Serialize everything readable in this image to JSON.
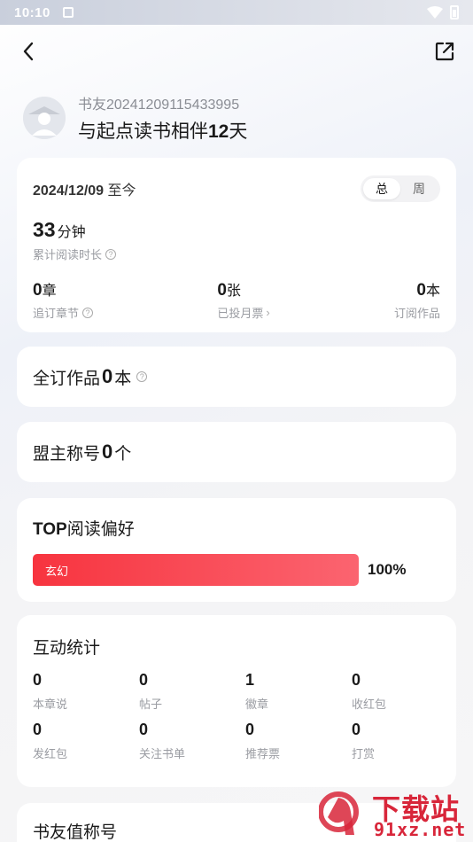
{
  "status_bar": {
    "time": "10:10"
  },
  "profile": {
    "username": "书友20241209115433995",
    "companion_prefix": "与起点读书相伴",
    "companion_days": "12",
    "companion_suffix": "天"
  },
  "stats": {
    "date_range": "2024/12/09",
    "date_suffix": "至今",
    "toggle": [
      "总",
      "周"
    ],
    "read_time_value": "33",
    "read_time_unit": "分钟",
    "read_time_label": "累计阅读时长",
    "chapters_value": "0",
    "chapters_unit": "章",
    "chapters_label": "追订章节",
    "votes_value": "0",
    "votes_unit": "张",
    "votes_label": "已投月票",
    "subscribed_value": "0",
    "subscribed_unit": "本",
    "subscribed_label": "订阅作品"
  },
  "full_sub": {
    "label": "全订作品",
    "value": "0",
    "unit": "本"
  },
  "leader": {
    "label": "盟主称号",
    "value": "0",
    "unit": "个"
  },
  "top_pref": {
    "title_bold": "TOP",
    "title_rest": "阅读偏好",
    "genre": "玄幻",
    "percent_text": "100%",
    "percent": 100
  },
  "interaction": {
    "title": "互动统计",
    "items": [
      {
        "value": "0",
        "label": "本章说"
      },
      {
        "value": "0",
        "label": "帖子"
      },
      {
        "value": "1",
        "label": "徽章"
      },
      {
        "value": "0",
        "label": "收红包"
      },
      {
        "value": "0",
        "label": "发红包"
      },
      {
        "value": "0",
        "label": "关注书单"
      },
      {
        "value": "0",
        "label": "推荐票"
      },
      {
        "value": "0",
        "label": "打赏"
      }
    ]
  },
  "title_card": {
    "title": "书友值称号"
  },
  "watermark": {
    "line1": "下载站",
    "line2": "91xz.net"
  },
  "colors": {
    "accent": "#f7343f",
    "watermark": "#d8263a"
  }
}
